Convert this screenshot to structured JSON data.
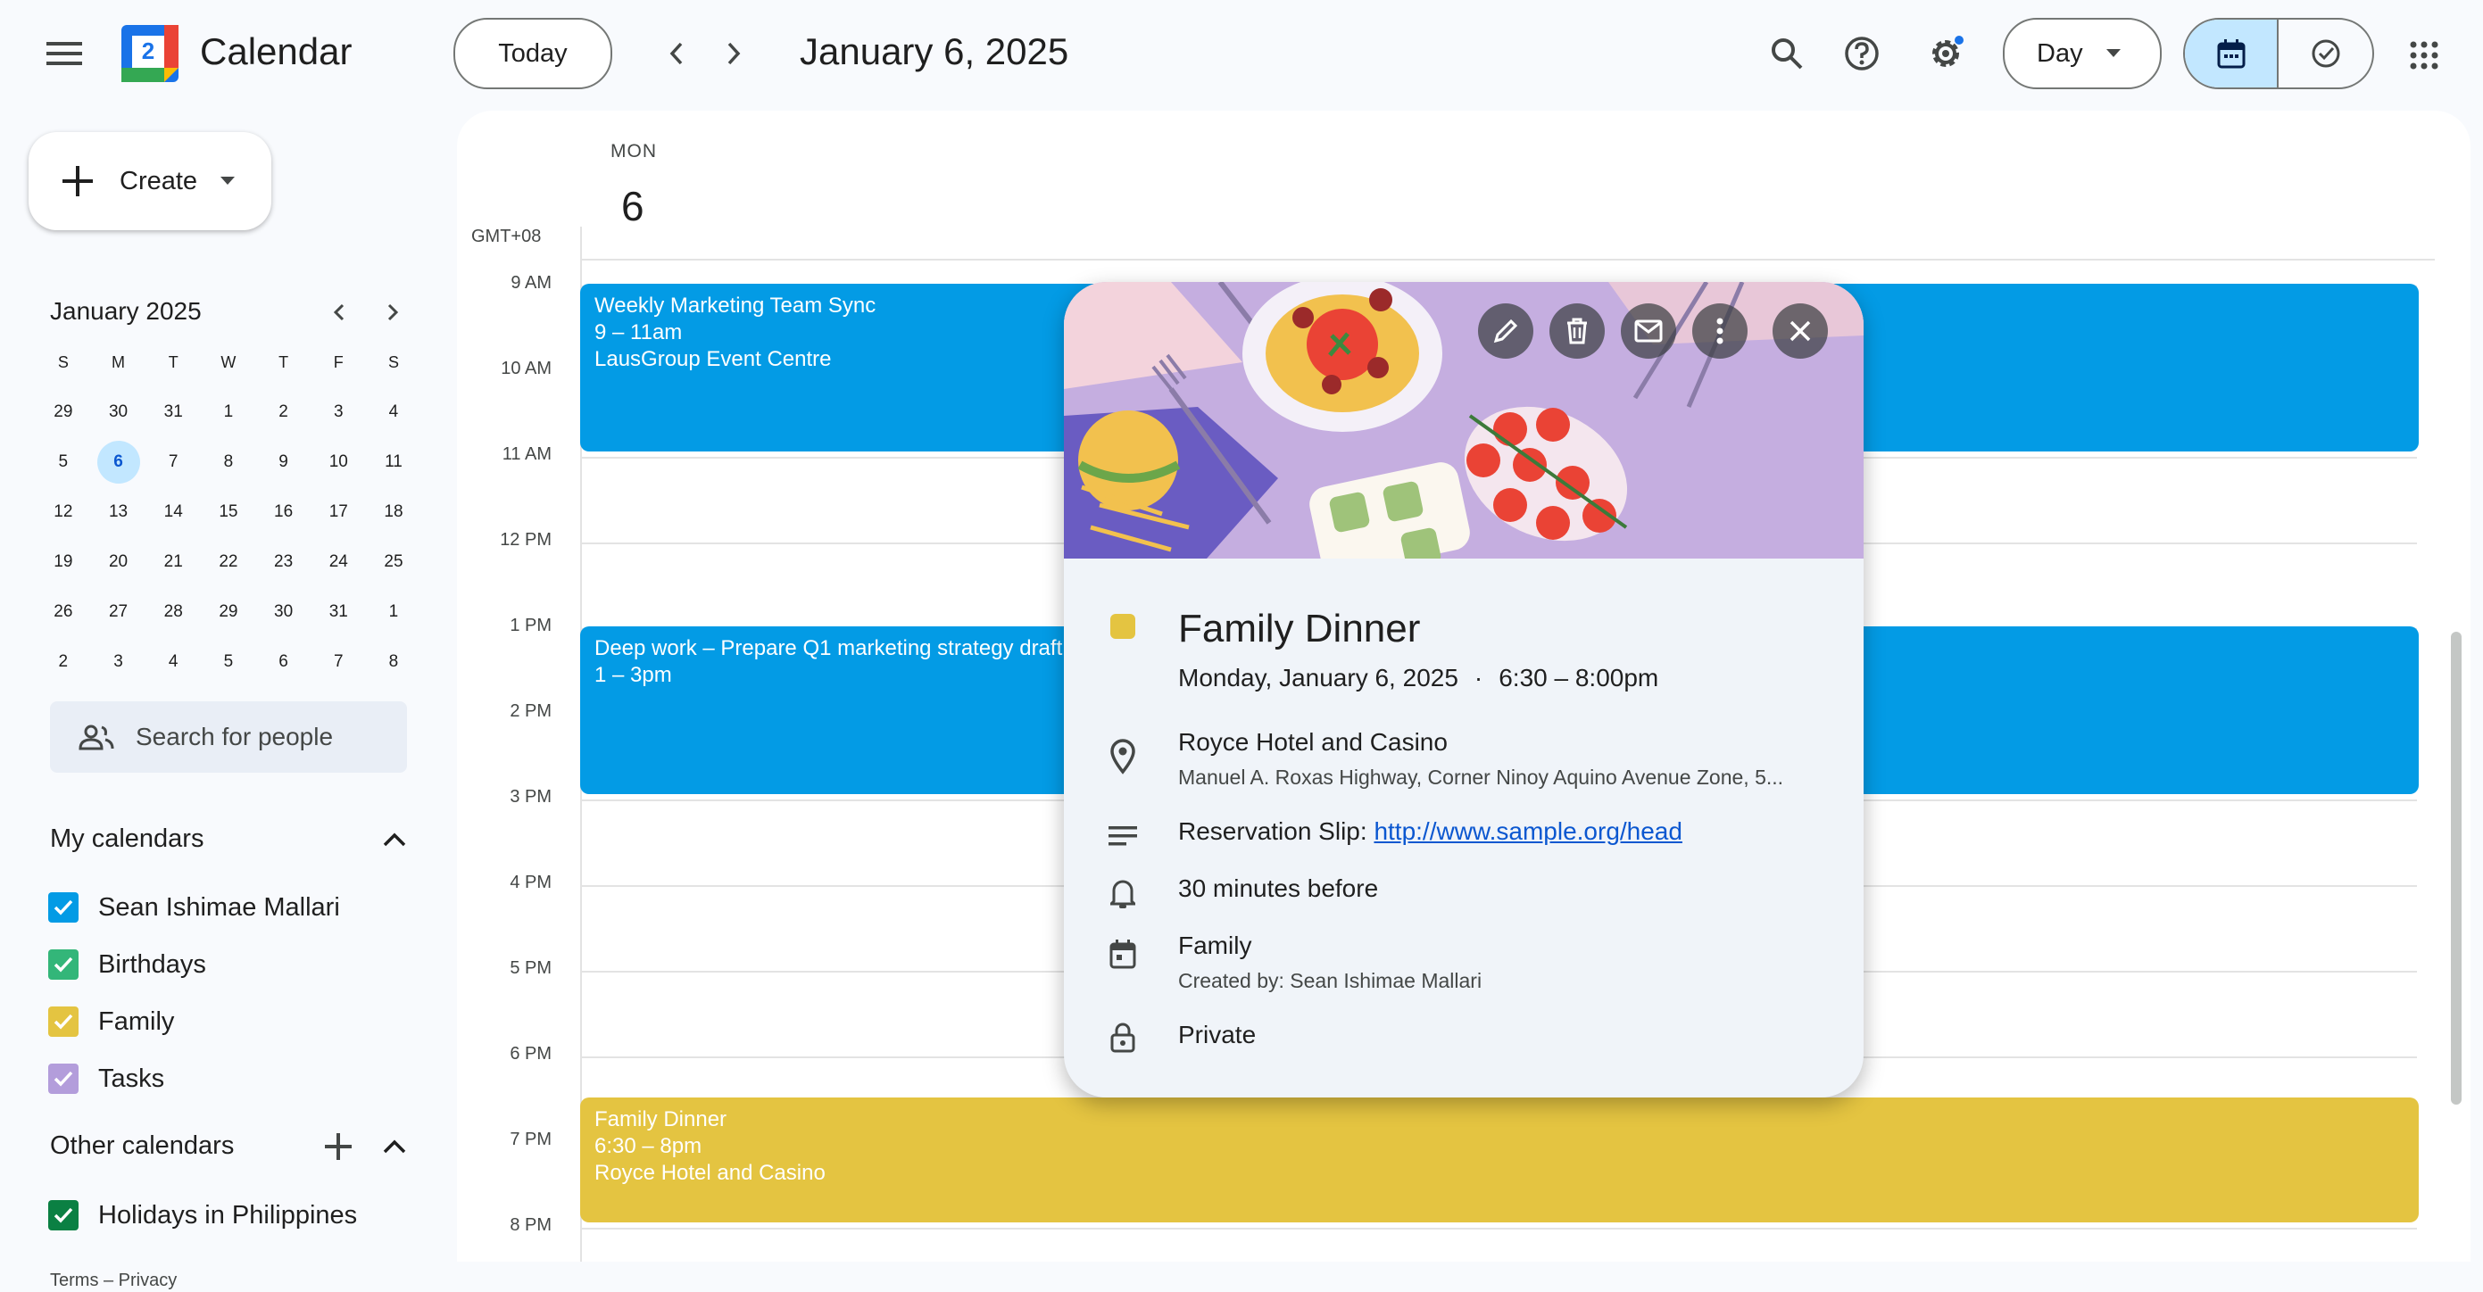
{
  "app": {
    "title": "Calendar",
    "logo_day": "2"
  },
  "header": {
    "today_label": "Today",
    "date_title": "January 6, 2025",
    "view_label": "Day"
  },
  "sidebar": {
    "create_label": "Create",
    "mini_month": "January 2025",
    "weekday_headers": [
      "S",
      "M",
      "T",
      "W",
      "T",
      "F",
      "S"
    ],
    "weeks": [
      [
        "29",
        "30",
        "31",
        "1",
        "2",
        "3",
        "4"
      ],
      [
        "5",
        "6",
        "7",
        "8",
        "9",
        "10",
        "11"
      ],
      [
        "12",
        "13",
        "14",
        "15",
        "16",
        "17",
        "18"
      ],
      [
        "19",
        "20",
        "21",
        "22",
        "23",
        "24",
        "25"
      ],
      [
        "26",
        "27",
        "28",
        "29",
        "30",
        "31",
        "1"
      ],
      [
        "2",
        "3",
        "4",
        "5",
        "6",
        "7",
        "8"
      ]
    ],
    "selected_day": "6",
    "search_people_placeholder": "Search for people",
    "my_calendars_title": "My calendars",
    "my_calendars": [
      {
        "name": "Sean Ishimae Mallari",
        "color": "#039be5"
      },
      {
        "name": "Birthdays",
        "color": "#33b679"
      },
      {
        "name": "Family",
        "color": "#e4c441"
      },
      {
        "name": "Tasks",
        "color": "#b39ddb"
      }
    ],
    "other_calendars_title": "Other calendars",
    "other_calendars": [
      {
        "name": "Holidays in Philippines",
        "color": "#0b8043"
      }
    ],
    "footer": "Terms – Privacy"
  },
  "day_view": {
    "weekday": "MON",
    "day_number": "6",
    "timezone": "GMT+08",
    "hours": [
      "9 AM",
      "10 AM",
      "11 AM",
      "12 PM",
      "1 PM",
      "2 PM",
      "3 PM",
      "4 PM",
      "5 PM",
      "6 PM",
      "7 PM",
      "8 PM"
    ],
    "events": [
      {
        "title": "Weekly Marketing Team Sync",
        "time": "9 – 11am",
        "location": "LausGroup Event Centre",
        "color": "#039be5"
      },
      {
        "title": "Deep work – Prepare Q1 marketing strategy draft",
        "time": "1 – 3pm",
        "location": "",
        "color": "#039be5"
      },
      {
        "title": "Family Dinner",
        "time": "6:30 – 8pm",
        "location": "Royce Hotel and Casino",
        "color": "#e4c441"
      }
    ]
  },
  "popup": {
    "title": "Family Dinner",
    "color": "#e4c441",
    "date": "Monday, January 6, 2025",
    "separator": "·",
    "time": "6:30 – 8:00pm",
    "location_name": "Royce Hotel and Casino",
    "location_address": "Manuel A. Roxas Highway, Corner Ninoy Aquino Avenue Zone, 5...",
    "description_label": "Reservation Slip: ",
    "description_link": "http://www.sample.org/head",
    "reminder": "30 minutes before",
    "calendar_name": "Family",
    "created_by": "Created by: Sean Ishimae Mallari",
    "visibility": "Private"
  }
}
